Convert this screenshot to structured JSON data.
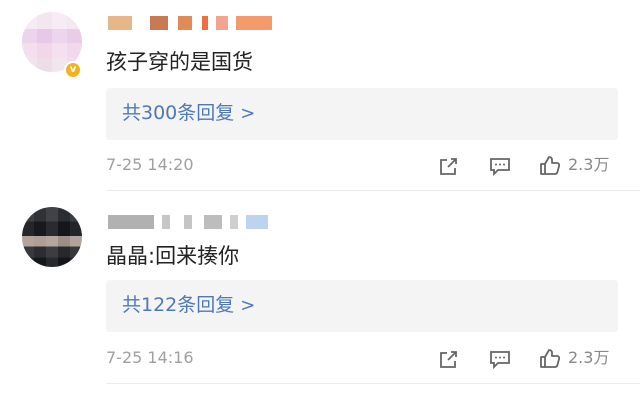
{
  "comments": [
    {
      "text": "孩子穿的是国货",
      "reply_summary": "共300条回复",
      "time": "7-25 14:20",
      "like_count": "2.3万"
    },
    {
      "text": "晶晶:回来揍你",
      "reply_summary": "共122条回复",
      "time": "7-25 14:16",
      "like_count": "2.3万"
    }
  ],
  "icons": {
    "share": "share-icon",
    "comment": "comment-icon",
    "like": "thumbs-up-icon",
    "reply_chevron": ">"
  },
  "colors": {
    "reply_link": "#4e79b7",
    "reply_background": "#f4f4f4",
    "meta_text": "#a0a0a0"
  }
}
